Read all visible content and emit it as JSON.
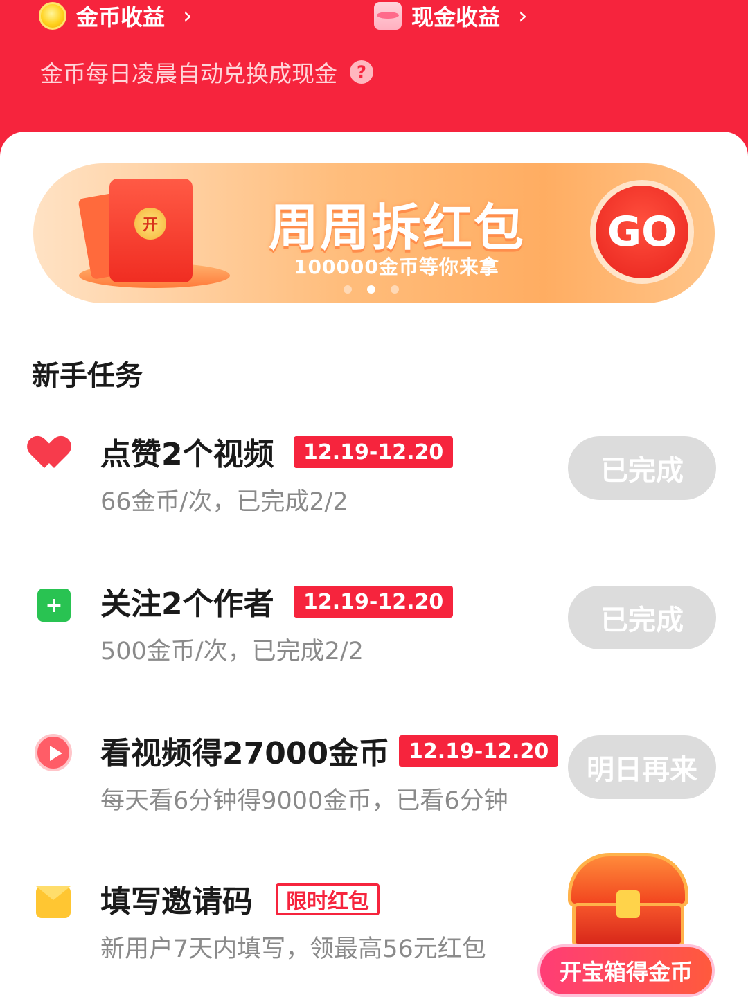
{
  "header": {
    "coin_earnings_label": "金币收益",
    "cash_earnings_label": "现金收益",
    "chevron": "›",
    "subtitle": "金币每日凌晨自动兑换成现金",
    "help_icon": "?"
  },
  "banner": {
    "title": "周周拆红包",
    "subtitle": "100000金币等你来拿",
    "go_label": "GO",
    "envelope_seal": "开",
    "active_slide": 2,
    "slide_count": 3
  },
  "section": {
    "title": "新手任务"
  },
  "tasks": [
    {
      "icon": "heart-icon",
      "name": "点赞2个视频",
      "badge": "12.19-12.20",
      "desc": "66金币/次，已完成2/2",
      "button": "已完成"
    },
    {
      "icon": "follow-icon",
      "icon_glyph": "+",
      "name": "关注2个作者",
      "badge": "12.19-12.20",
      "desc": "500金币/次，已完成2/2",
      "button": "已完成"
    },
    {
      "icon": "play-icon",
      "name": "看视频得27000金币",
      "badge": "12.19-12.20",
      "desc": "每天看6分钟得9000金币，已看6分钟",
      "button": "明日再来"
    },
    {
      "icon": "mail-icon",
      "name": "填写邀请码",
      "badge": "限时红包",
      "desc": "新用户7天内填写，领最高56元红包",
      "button": ""
    }
  ],
  "treasure": {
    "button_label": "开宝箱得金币"
  },
  "colors": {
    "brand_red": "#f6243d",
    "disabled_button": "#dcdcdc",
    "banner_orange": "#ffad62"
  }
}
